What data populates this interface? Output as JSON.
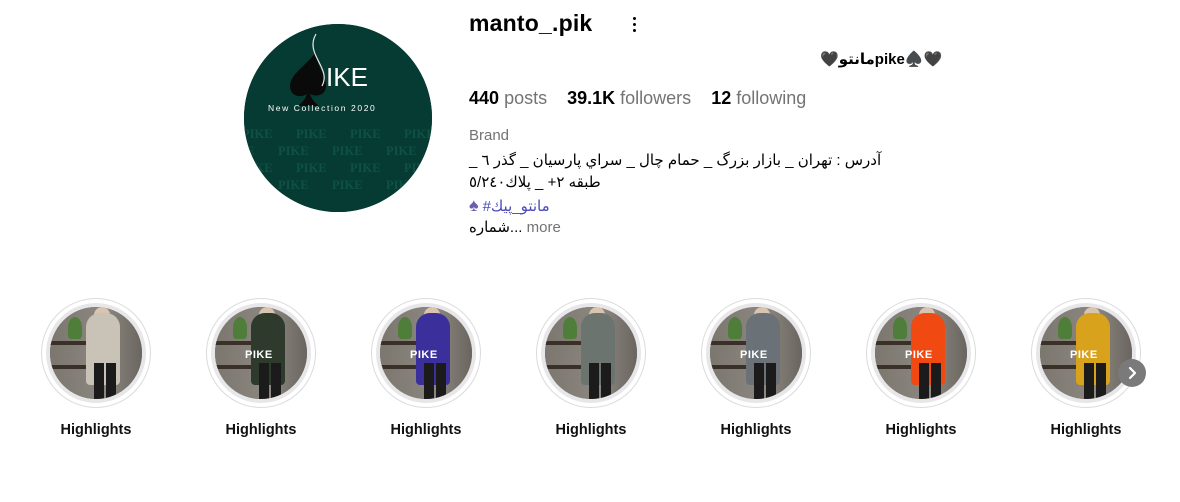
{
  "profile": {
    "username": "manto_.pik",
    "full_name": "🖤مانتوpike♠️🖤",
    "stats": {
      "posts_count": "440",
      "posts_label": "posts",
      "followers_count": "39.1K",
      "followers_label": "followers",
      "following_count": "12",
      "following_label": "following"
    },
    "category": "Brand",
    "bio_line1": "آدرس : تهران _ بازار بزرگ _ حمام چال _ سراي پارسيان _ گذر ٦ _",
    "bio_line2": "طبقه ٢+ _ پلاك٥/٢٤٠",
    "hashtag": "#مانتو_پيك",
    "bio_line3": "شماره...",
    "more_label": "more"
  },
  "avatar": {
    "brand_text": "IKE",
    "subtitle": "New Collection 2020",
    "pattern_text": "PIKE"
  },
  "highlights": [
    {
      "label": "Highlights",
      "coat_color": "#c8c3b6"
    },
    {
      "label": "Highlights",
      "coat_color": "#2e3a2c"
    },
    {
      "label": "Highlights",
      "coat_color": "#3b2f9c"
    },
    {
      "label": "Highlights",
      "coat_color": "#6c7470"
    },
    {
      "label": "Highlights",
      "coat_color": "#6a7278"
    },
    {
      "label": "Highlights",
      "coat_color": "#f04a12"
    },
    {
      "label": "Highlights",
      "coat_color": "#d8a21c"
    }
  ],
  "highlight_logo": "PIKE",
  "icons": {
    "more": "more-horizontal-icon",
    "next": "chevron-right-icon",
    "spade": "spade-icon"
  },
  "colors": {
    "avatar_bg": "#063b33",
    "link": "#4a4ab8",
    "muted": "#737373"
  }
}
